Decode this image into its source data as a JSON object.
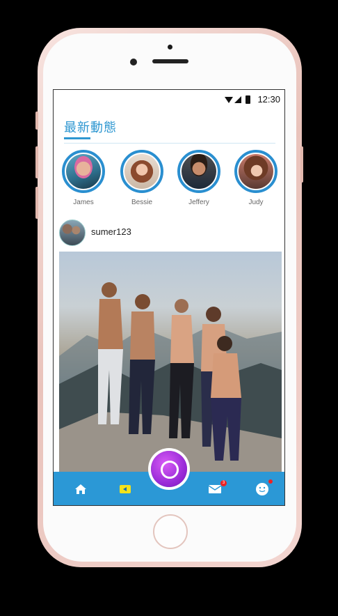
{
  "status": {
    "time": "12:30"
  },
  "header": {
    "title": "最新動態"
  },
  "stories": [
    {
      "name": "James",
      "avatar": "person-with-sunglasses"
    },
    {
      "name": "Bessie",
      "avatar": "woman-curly-hair"
    },
    {
      "name": "Jeffery",
      "avatar": "smiling-man"
    },
    {
      "name": "Judy",
      "avatar": "woman-with-flowers"
    }
  ],
  "post": {
    "username": "sumer123",
    "image": "group-of-friends-on-mountain"
  },
  "nav": {
    "mail_badge": "3",
    "items": [
      "home-icon",
      "play-icon",
      "record-icon",
      "mail-icon",
      "profile-icon"
    ]
  },
  "colors": {
    "accent": "#2b98d6",
    "record": "#9a2cd8",
    "badge": "#e22222"
  }
}
